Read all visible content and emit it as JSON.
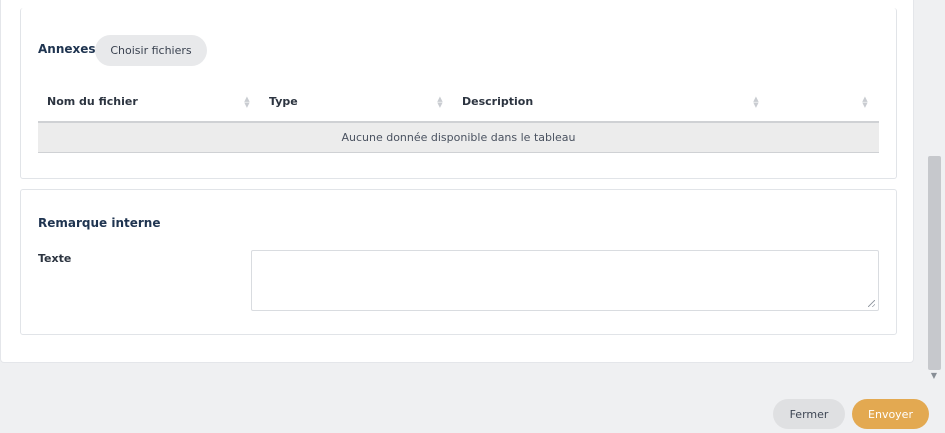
{
  "annexes": {
    "title": "Annexes",
    "choose_files_label": "Choisir fichiers",
    "table": {
      "columns": [
        "Nom du fichier",
        "Type",
        "Description",
        ""
      ],
      "empty_message": "Aucune donnée disponible dans le tableau"
    }
  },
  "remarque": {
    "title": "Remarque interne",
    "field_label": "Texte",
    "field_value": ""
  },
  "footer": {
    "close_label": "Fermer",
    "send_label": "Envoyer"
  },
  "colors": {
    "accent": "#e3a951",
    "title": "#1f3450"
  }
}
